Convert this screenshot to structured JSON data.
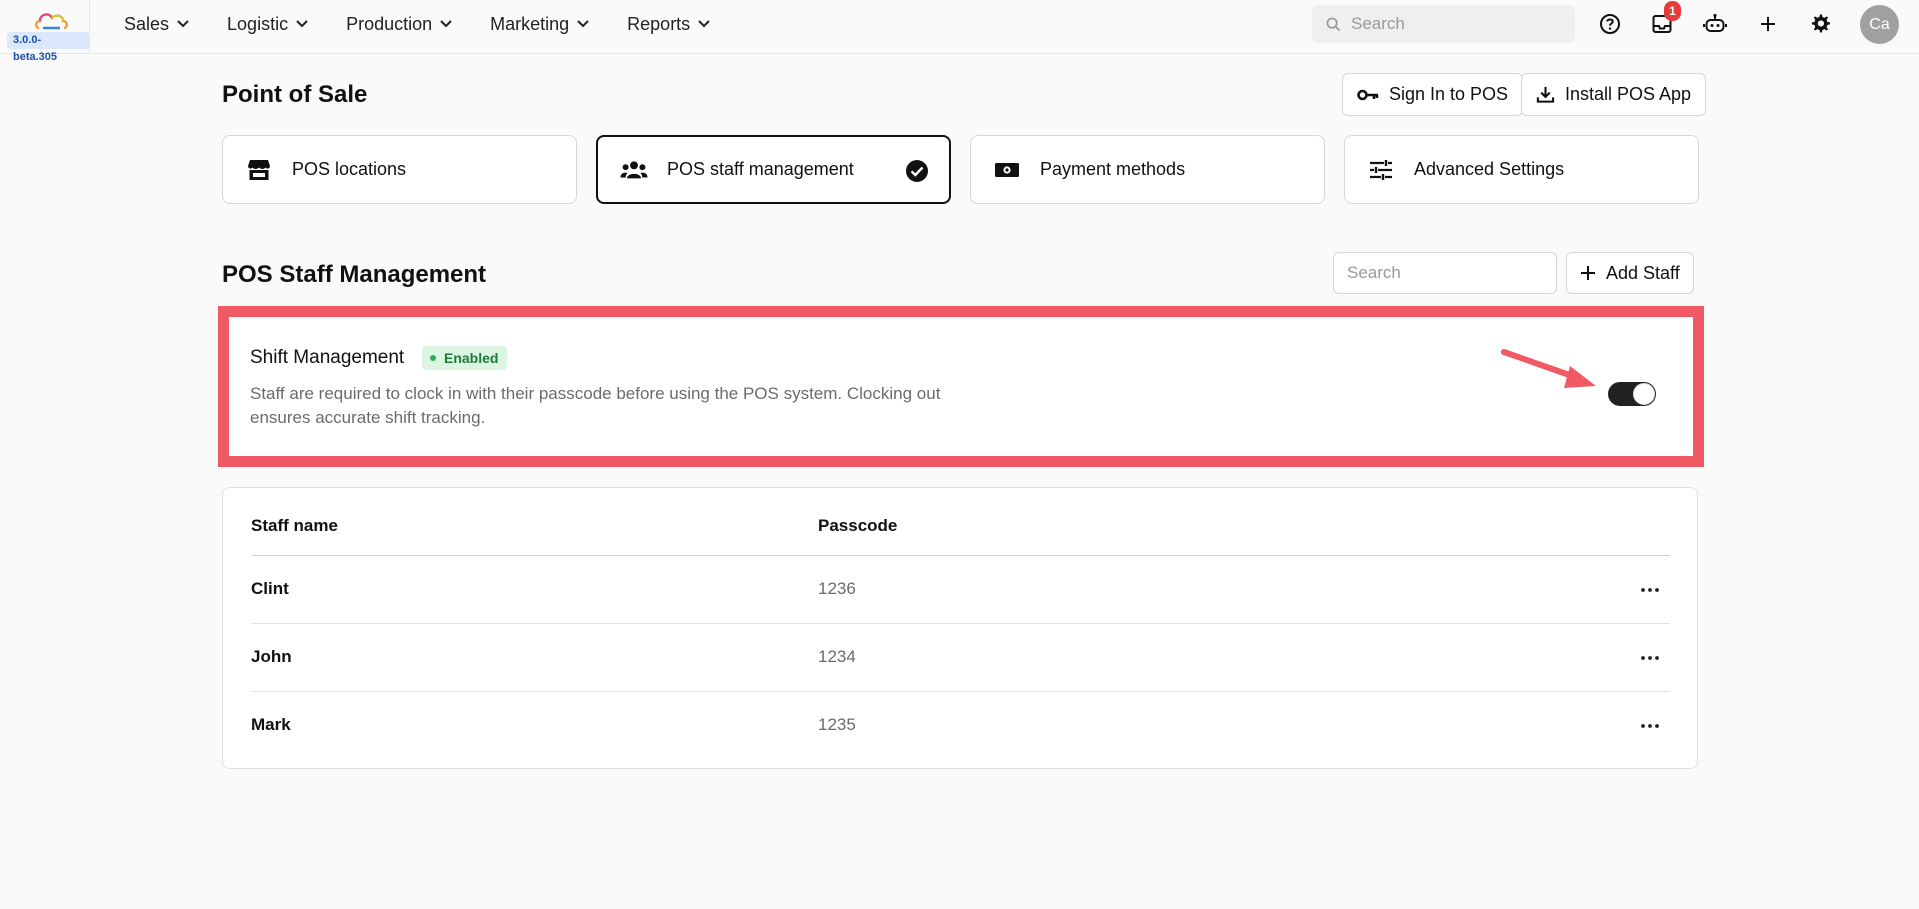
{
  "app": {
    "version": "3.0.0-beta.305",
    "nav": [
      "Sales",
      "Logistic",
      "Production",
      "Marketing",
      "Reports"
    ],
    "search_placeholder": "Search",
    "notification_count": "1",
    "avatar_initials": "Ca"
  },
  "page": {
    "title": "Point of Sale",
    "sign_in_label": "Sign In to POS",
    "install_label": "Install POS App"
  },
  "tabs": [
    {
      "label": "POS locations",
      "icon": "store-icon",
      "active": false
    },
    {
      "label": "POS staff management",
      "icon": "users-icon",
      "active": true
    },
    {
      "label": "Payment methods",
      "icon": "money-icon",
      "active": false
    },
    {
      "label": "Advanced Settings",
      "icon": "sliders-icon",
      "active": false
    }
  ],
  "staff": {
    "title": "POS Staff Management",
    "search_placeholder": "Search",
    "add_label": "Add Staff"
  },
  "shift": {
    "title": "Shift Management",
    "status": "Enabled",
    "description": "Staff are required to clock in with their passcode before using the POS system. Clocking out ensures accurate shift tracking.",
    "enabled": true
  },
  "table": {
    "headers": [
      "Staff name",
      "Passcode"
    ],
    "rows": [
      {
        "name": "Clint",
        "passcode": "1236"
      },
      {
        "name": "John",
        "passcode": "1234"
      },
      {
        "name": "Mark",
        "passcode": "1235"
      }
    ]
  },
  "colors": {
    "highlight": "#ef5a64",
    "enabled_badge_bg": "#dcf5e3",
    "enabled_text": "#1f7a3a",
    "notification": "#e63b3b"
  }
}
